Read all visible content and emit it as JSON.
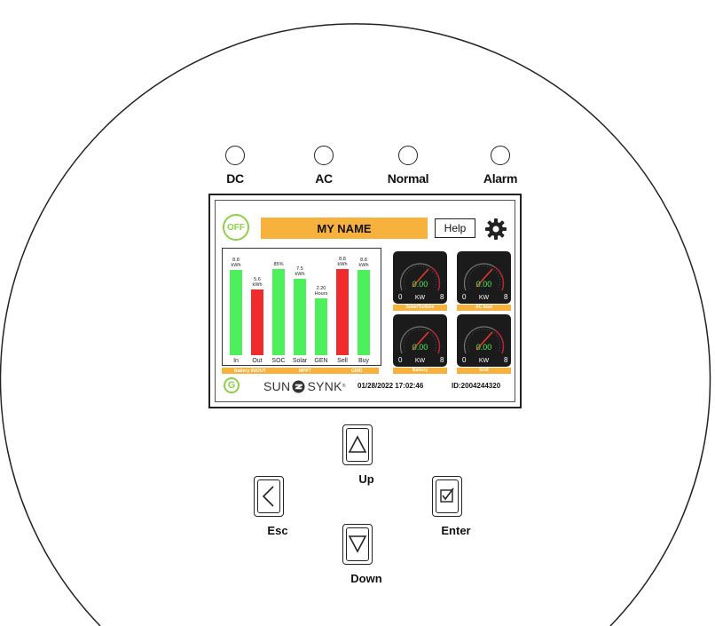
{
  "indicators": [
    {
      "key": "dc",
      "label": "DC"
    },
    {
      "key": "ac",
      "label": "AC"
    },
    {
      "key": "normal",
      "label": "Normal"
    },
    {
      "key": "alarm",
      "label": "Alarm"
    }
  ],
  "screen": {
    "power_button": "OFF",
    "name_bar": "MY NAME",
    "help_button": "Help",
    "icons": {
      "settings": "gear-icon",
      "grid_status": "g-icon",
      "logo": "sunsynk-logo"
    },
    "bar_chart": {
      "bars": [
        {
          "category": "In",
          "value_label": [
            "8.8",
            "kWh"
          ],
          "color": "#4cf05a"
        },
        {
          "category": "Out",
          "value_label": [
            "5.6",
            "kWh"
          ],
          "color": "#ef2b2b"
        },
        {
          "category": "SOC",
          "value_label": [
            "85%"
          ],
          "color": "#4cf05a"
        },
        {
          "category": "Solar",
          "value_label": [
            "7.5",
            "kWh"
          ],
          "color": "#4cf05a"
        },
        {
          "category": "GEN",
          "value_label": [
            "2.20",
            "Hours"
          ],
          "color": "#4cf05a"
        },
        {
          "category": "Sell",
          "value_label": [
            "8.8",
            "kWh"
          ],
          "color": "#ef2b2b"
        },
        {
          "category": "Buy",
          "value_label": [
            "8.8",
            "kWh"
          ],
          "color": "#4cf05a"
        }
      ],
      "group_labels": [
        "Battery IN/OUT",
        "MPPT",
        "GRID"
      ]
    },
    "gauges": [
      {
        "name": "Solar/Turbine",
        "value": "0.00",
        "unit": "KW",
        "min": "0",
        "max": "8"
      },
      {
        "name": "AC load",
        "value": "0.00",
        "unit": "KW",
        "min": "0",
        "max": "8"
      },
      {
        "name": "Battery",
        "value": "0.00",
        "unit": "KW",
        "min": "0",
        "max": "8"
      },
      {
        "name": "Grid",
        "value": "0.00",
        "unit": "KW",
        "min": "0",
        "max": "8"
      }
    ],
    "footer": {
      "grid_icon_letter": "G",
      "logo_left": "SUN",
      "logo_right": "SYNK",
      "logo_reg": "®",
      "datetime": "01/28/2022 17:02:46",
      "device_id": "ID:2004244320"
    },
    "colors": {
      "accent": "#f6b23c",
      "green": "#4cf05a",
      "red": "#ef2b2b",
      "gauge_value": "#4cf05a",
      "needle": "#e53a2a"
    }
  },
  "buttons": {
    "up": "Up",
    "down": "Down",
    "esc": "Esc",
    "enter": "Enter"
  }
}
